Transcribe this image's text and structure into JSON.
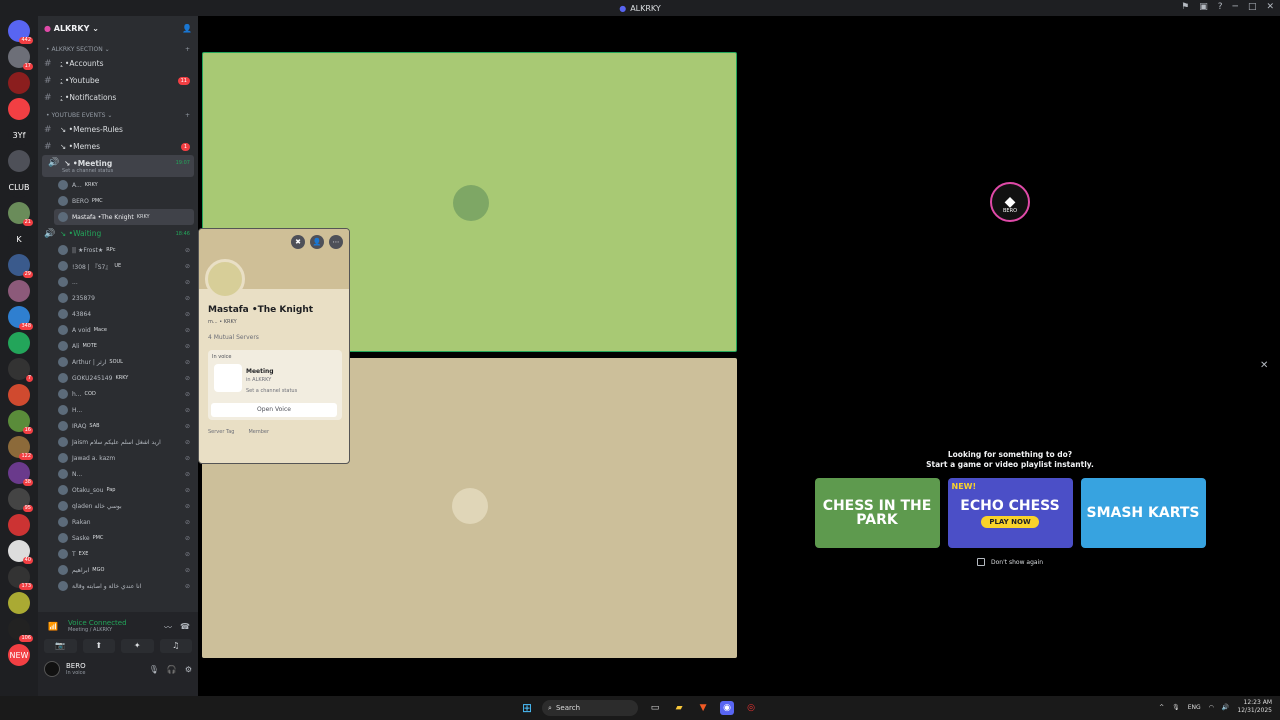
{
  "titlebar": {
    "title": "ALKRKY"
  },
  "guilds": [
    {
      "label": "",
      "badge": "442",
      "color": "#5865f2"
    },
    {
      "label": "",
      "badge": "17",
      "color": "#6d6f78"
    },
    {
      "label": "",
      "badge": "",
      "color": "#8b1e1e"
    },
    {
      "label": "",
      "badge": "",
      "color": "#f23f43"
    },
    {
      "label": "3Yf",
      "badge": "",
      "color": "#1e1f22"
    },
    {
      "label": "",
      "badge": "",
      "color": "#4e5058"
    },
    {
      "label": "CLUB",
      "badge": "",
      "color": "#1e1f22"
    },
    {
      "label": "",
      "badge": "21",
      "color": "#6a8c5a"
    },
    {
      "label": "K",
      "badge": "",
      "color": "#1e1f22"
    },
    {
      "label": "",
      "badge": "29",
      "color": "#3a5a8c"
    },
    {
      "label": "",
      "badge": "",
      "color": "#8c5a7a"
    },
    {
      "label": "",
      "badge": "348",
      "color": "#2f7fd0"
    },
    {
      "label": "",
      "badge": "",
      "color": "#23a55a"
    },
    {
      "label": "",
      "badge": "7",
      "color": "#333"
    },
    {
      "label": "",
      "badge": "",
      "color": "#d04a2f"
    },
    {
      "label": "",
      "badge": "16",
      "color": "#5a8c3a"
    },
    {
      "label": "",
      "badge": "122",
      "color": "#8c6a3a"
    },
    {
      "label": "",
      "badge": "38",
      "color": "#6a3a8c"
    },
    {
      "label": "",
      "badge": "95",
      "color": "#444"
    },
    {
      "label": "",
      "badge": "",
      "color": "#c33"
    },
    {
      "label": "",
      "badge": "40",
      "color": "#ddd"
    },
    {
      "label": "",
      "badge": "173",
      "color": "#333"
    },
    {
      "label": "",
      "badge": "",
      "color": "#aa3"
    },
    {
      "label": "",
      "badge": "106",
      "color": "#222"
    },
    {
      "label": "NEW",
      "badge": "",
      "color": "#f23f43"
    }
  ],
  "server": {
    "name": "ALKRKY"
  },
  "sections": {
    "alkrky": "ALKRKY SECTION",
    "youtube": "YOUTUBE EVENTS"
  },
  "channels": {
    "accounts": "Accounts",
    "youtube": "Youtube",
    "youtube_badge": "11",
    "notifications": "Notifications",
    "memes_rules": "Memes-Rules",
    "memes": "Memes",
    "memes_badge": "1",
    "meeting": "Meeting",
    "meeting_time": "19:07",
    "meeting_status": "Set a channel status",
    "waiting": "Waiting",
    "waiting_time": "18:46"
  },
  "meeting_users": [
    {
      "name": "A...",
      "tag": "KRKY"
    },
    {
      "name": "BERO",
      "tag": "PMC"
    },
    {
      "name": "Mastafa •The Knight",
      "tag": "KRKY"
    }
  ],
  "waiting_users": [
    {
      "name": "|| ★Frost★",
      "tag": "RPc"
    },
    {
      "name": "!308 | 『S7』",
      "tag": "UE"
    },
    {
      "name": "...",
      "tag": ""
    },
    {
      "name": "235879",
      "tag": ""
    },
    {
      "name": "43864",
      "tag": ""
    },
    {
      "name": "A void",
      "tag": "Mace"
    },
    {
      "name": "Ali",
      "tag": "MOTE"
    },
    {
      "name": "Arthur | ارثر",
      "tag": "SOUL"
    },
    {
      "name": "GOKU245149",
      "tag": "KRKY"
    },
    {
      "name": "h...",
      "tag": "COD"
    },
    {
      "name": "H...",
      "tag": ""
    },
    {
      "name": "IRAQ",
      "tag": "SAB"
    },
    {
      "name": "Jaism اريد اشغل اسلم عليكم سلام",
      "tag": ""
    },
    {
      "name": "Jawad a. kazm",
      "tag": ""
    },
    {
      "name": "N...",
      "tag": ""
    },
    {
      "name": "Otaku_sou",
      "tag": "Pap"
    },
    {
      "name": "qladen بوسي خالة",
      "tag": ""
    },
    {
      "name": "Rakan",
      "tag": ""
    },
    {
      "name": "Saske",
      "tag": "PMC"
    },
    {
      "name": "T",
      "tag": "EXE"
    },
    {
      "name": "ابراهيم",
      "tag": "MGO"
    },
    {
      "name": "انا عندي خالة و اصابته وقالة",
      "tag": ""
    }
  ],
  "voice": {
    "status": "Voice Connected",
    "location": "Meeting / ALKRKY"
  },
  "me": {
    "name": "BERO",
    "status": "In voice"
  },
  "popout": {
    "name": "Mastafa •The Knight",
    "mini": "m... •  KRKY",
    "mutual": "4 Mutual Servers",
    "in_voice": "In voice",
    "channel": "Meeting",
    "server": "in ALKRKY",
    "channel_status": "Set a channel status",
    "open_voice": "Open Voice",
    "role1": "Server Tag",
    "role2": "Member"
  },
  "bero_tile": {
    "label": "BERO"
  },
  "activity": {
    "line1": "Looking for something to do?",
    "line2": "Start a game or video playlist instantly.",
    "cards": [
      {
        "title": "CHESS IN THE PARK",
        "top": "",
        "play": ""
      },
      {
        "title": "ECHO CHESS",
        "top": "NEW!",
        "play": "PLAY NOW"
      },
      {
        "title": "SMASH KARTS",
        "top": "",
        "play": ""
      }
    ],
    "dont_show": "Don't show again"
  },
  "taskbar": {
    "search": "Search",
    "lang": "ENG",
    "time": "12:23 AM",
    "date": "12/31/2025"
  },
  "colors": {
    "accent": "#5865f2",
    "green": "#23a55a",
    "red": "#f23f43"
  }
}
